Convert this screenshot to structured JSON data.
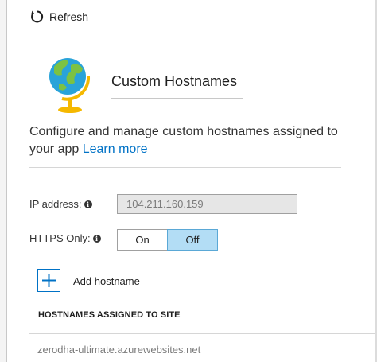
{
  "toolbar": {
    "refresh_label": "Refresh",
    "refresh_icon": "refresh-icon"
  },
  "header": {
    "title": "Custom Hostnames",
    "icon": "globe-icon"
  },
  "description": {
    "text": "Configure and manage custom hostnames assigned to your app",
    "link": "Learn more"
  },
  "ip": {
    "label": "IP address:",
    "value": "104.211.160.159"
  },
  "https": {
    "label": "HTTPS Only:",
    "options": [
      "On",
      "Off"
    ],
    "selected": "Off"
  },
  "add_hostname": {
    "label": "Add hostname"
  },
  "hostnames": {
    "header": "HOSTNAMES ASSIGNED TO SITE",
    "items": [
      "zerodha-ultimate.azurewebsites.net"
    ]
  },
  "colors": {
    "accent": "#0072c6",
    "toggle_selected": "#b3ddf5",
    "globe_land": "#7cc242",
    "globe_water": "#29a3d9",
    "globe_stand": "#f5b800"
  }
}
